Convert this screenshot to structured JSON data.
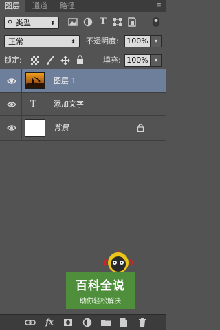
{
  "tabs": [
    {
      "label": "图层"
    },
    {
      "label": "通道"
    },
    {
      "label": "路径"
    }
  ],
  "filter": {
    "kind_label": "类型"
  },
  "blend": {
    "mode": "正常",
    "opacity_label": "不透明度:",
    "opacity_value": "100%"
  },
  "lock": {
    "label": "锁定:",
    "fill_label": "填充:",
    "fill_value": "100%"
  },
  "layers": [
    {
      "name": "图层 1",
      "type": "image",
      "selected": true
    },
    {
      "name": "添加文字",
      "type": "text",
      "selected": false
    },
    {
      "name": "背景",
      "type": "background",
      "selected": false,
      "locked": true
    }
  ],
  "watermark": {
    "title": "百科全说",
    "subtitle": "助你轻松解决"
  },
  "colors": {
    "panel_bg": "#535353",
    "selected_row": "#6d7f9a",
    "watermark_green": "#4f8f3c"
  }
}
